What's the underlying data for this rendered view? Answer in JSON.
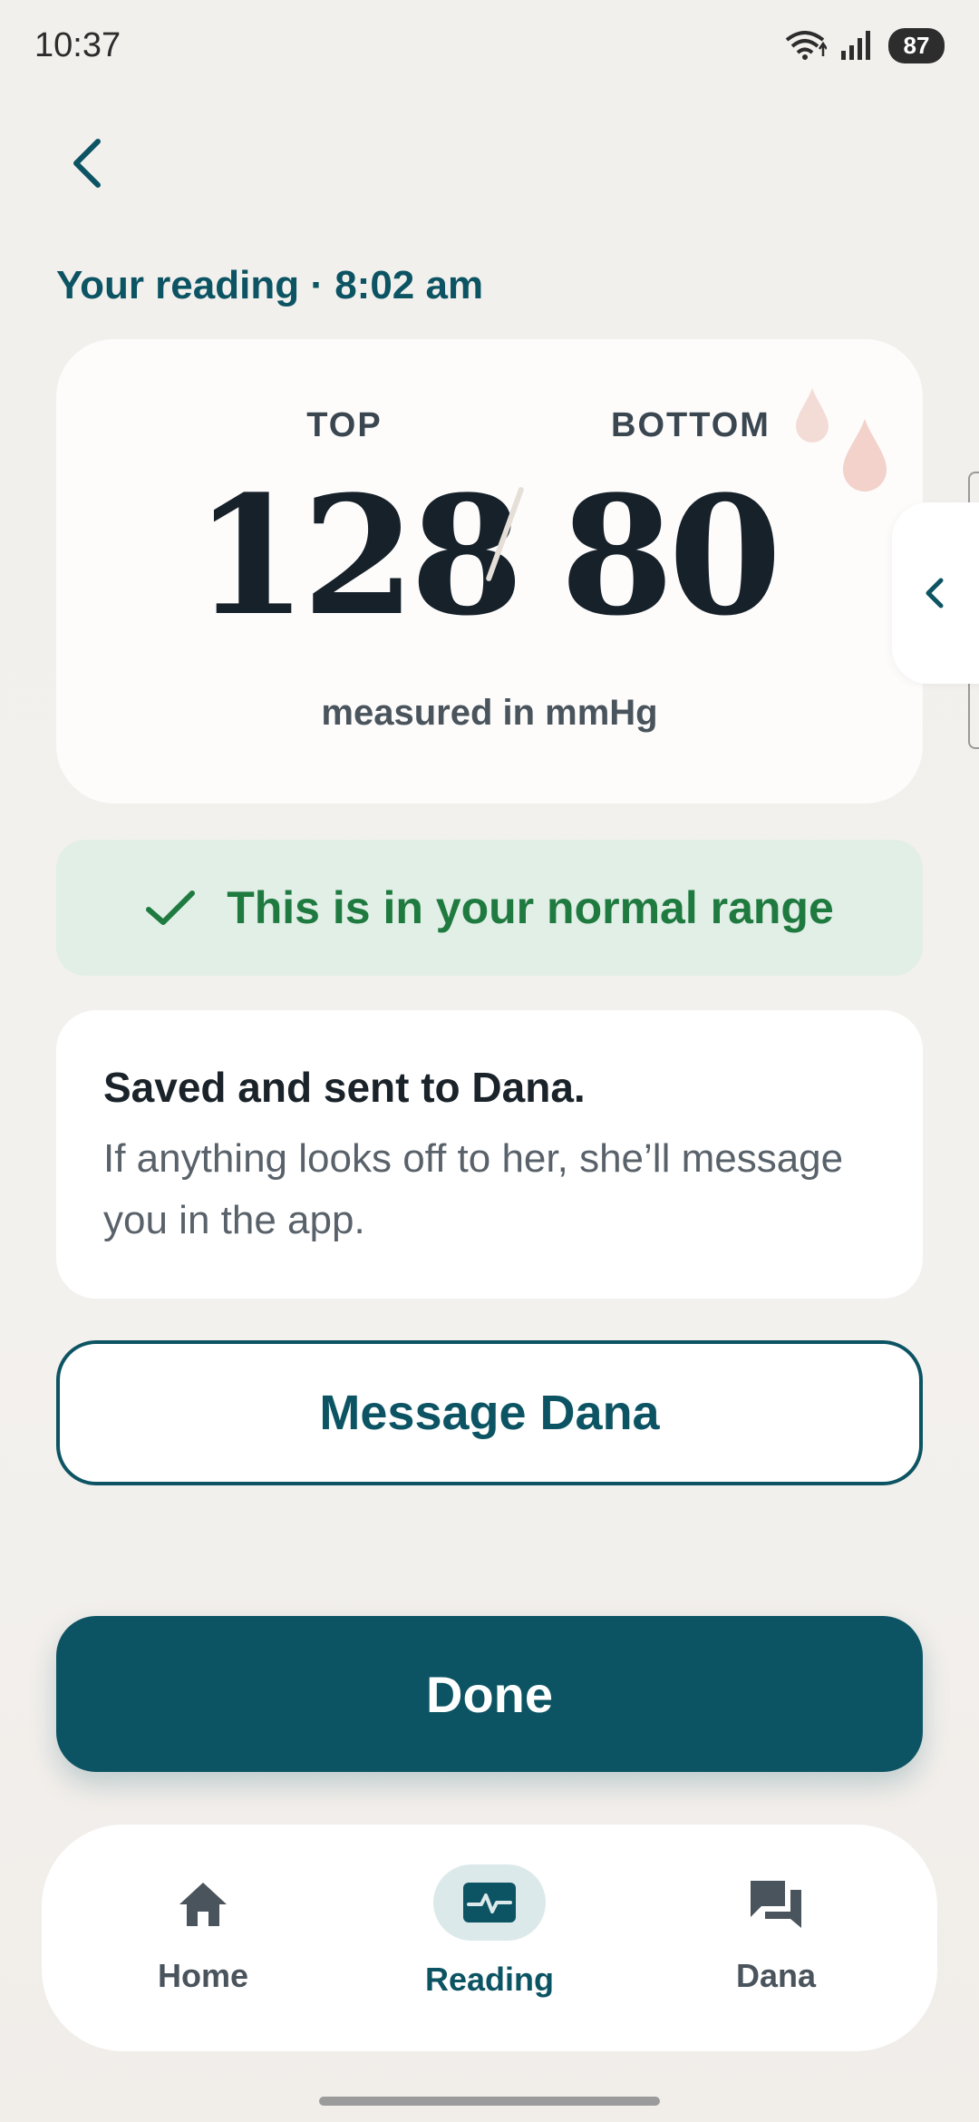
{
  "status_bar": {
    "time": "10:37",
    "battery": "87"
  },
  "header": {
    "reading_label": "Your reading · 8:02 am"
  },
  "reading": {
    "top_label": "TOP",
    "bottom_label": "BOTTOM",
    "top_value": "128",
    "bottom_value": "80",
    "unit": "measured in mmHg"
  },
  "range": {
    "text": "This is in your normal range"
  },
  "info": {
    "title": "Saved and sent to Dana.",
    "body": "If anything looks off to her, she’ll message you in the app."
  },
  "actions": {
    "message_label": "Message Dana",
    "done_label": "Done"
  },
  "nav": {
    "items": [
      {
        "label": "Home",
        "icon": "home-icon"
      },
      {
        "label": "Reading",
        "icon": "pulse-monitor-icon",
        "active": true
      },
      {
        "label": "Dana",
        "icon": "chat-bubbles-icon"
      }
    ]
  },
  "colors": {
    "accent": "#0c5463",
    "success": "#1f7a40",
    "success_bg": "#e1efe6",
    "drop": "#f2d5d0"
  }
}
